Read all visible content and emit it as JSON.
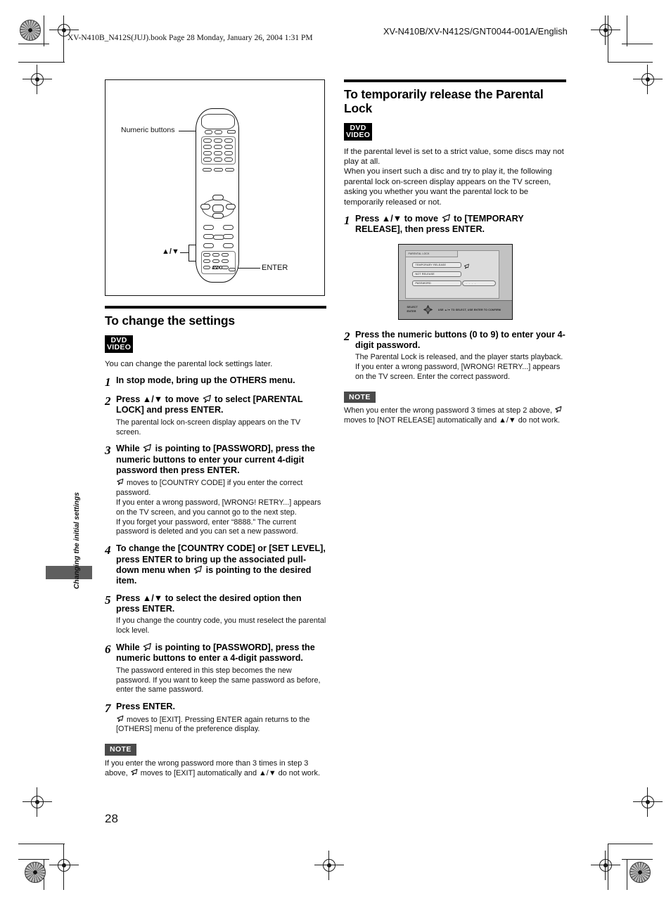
{
  "header": {
    "book_line": "XV-N410B_N412S(JUJ).book  Page 28  Monday, January 26, 2004  1:31 PM",
    "model_line": "XV-N410B/XV-N412S/GNT0044-001A/English"
  },
  "figure": {
    "label_numeric": "Numeric buttons",
    "label_updown": "▲/▼",
    "label_enter": "ENTER",
    "brand": "JVC"
  },
  "left_column": {
    "heading": "To change the settings",
    "logo_line1": "DVD",
    "logo_line2": "VIDEO",
    "intro": "You can change the parental lock settings later.",
    "steps": [
      {
        "num": "1",
        "title_parts": [
          "In stop mode, bring up the OTHERS menu."
        ],
        "body": []
      },
      {
        "num": "2",
        "title_pre": "Press ▲/▼ to move ",
        "title_post": " to select [PARENTAL LOCK] and press ENTER.",
        "body": [
          "The parental lock on-screen display appears on the TV screen."
        ]
      },
      {
        "num": "3",
        "title_pre": "While ",
        "title_post": " is pointing to [PASSWORD], press the numeric buttons to enter your current 4-digit password then press ENTER.",
        "body_cursor_lead": " moves to [COUNTRY CODE] if you enter the correct password.",
        "body": [
          "If you enter a wrong password, [WRONG! RETRY...] appears on the TV screen, and you cannot go to the next step.",
          "If you forget your password, enter “8888.” The current password is deleted and you can set a new password."
        ]
      },
      {
        "num": "4",
        "title_pre": "To change the [COUNTRY CODE] or [SET LEVEL], press ENTER to bring up the associated pull-down menu when ",
        "title_post": " is pointing to the desired item.",
        "body": []
      },
      {
        "num": "5",
        "title_parts": [
          "Press ▲/▼ to select the desired option then press ENTER."
        ],
        "body": [
          "If you change the country code, you must reselect the parental lock level."
        ]
      },
      {
        "num": "6",
        "title_pre": "While ",
        "title_post": " is pointing to [PASSWORD], press the numeric buttons to enter a 4-digit password.",
        "body": [
          "The password entered in this step becomes the new password. If you want to keep the same password as before, enter the same password."
        ]
      },
      {
        "num": "7",
        "title_parts": [
          "Press ENTER."
        ],
        "body_cursor_lead": " moves to [EXIT]. Pressing ENTER again returns to the [OTHERS] menu of the preference display.",
        "body": []
      }
    ],
    "note_badge": "NOTE",
    "note_pre": "If you enter the wrong password more than 3 times in step 3 above, ",
    "note_post": " moves to [EXIT] automatically and ▲/▼ do not work."
  },
  "right_column": {
    "heading": "To temporarily release the Parental Lock",
    "logo_line1": "DVD",
    "logo_line2": "VIDEO",
    "intro": [
      "If the parental level is set to a strict value, some discs may not play at all.",
      "When you insert such a disc and try to play it, the following parental lock on-screen display appears on the TV screen, asking you whether you want the parental lock to be temporarily released or not."
    ],
    "steps": [
      {
        "num": "1",
        "title_pre": "Press ▲/▼ to move ",
        "title_post": " to [TEMPORARY RELEASE], then press ENTER."
      },
      {
        "num": "2",
        "title_parts": [
          "Press the numeric buttons (0 to 9) to enter your 4-digit password."
        ],
        "body": [
          "The Parental Lock is released, and the player starts playback.",
          "If you enter a wrong password, [WRONG! RETRY...] appears on the TV screen. Enter the correct password."
        ]
      }
    ],
    "note_badge": "NOTE",
    "note_pre": "When you enter the wrong password 3 times at step 2 above, ",
    "note_post": " moves to [NOT RELEASE] automatically and ▲/▼ do not work."
  },
  "tv_screen": {
    "title": "PARENTAL LOCK",
    "rows": [
      "TEMPORARY RELEASE",
      "NOT RELEASE",
      "PASSWORD"
    ],
    "password_value": "- - - -",
    "footer_left_line1": "SELECT",
    "footer_left_line2": "ENTER",
    "footer_right": "USE ▲/▼ TO SELECT, USE ENTER TO CONFIRM"
  },
  "sidebar": {
    "label": "Changing the initial settings"
  },
  "page_number": "28"
}
